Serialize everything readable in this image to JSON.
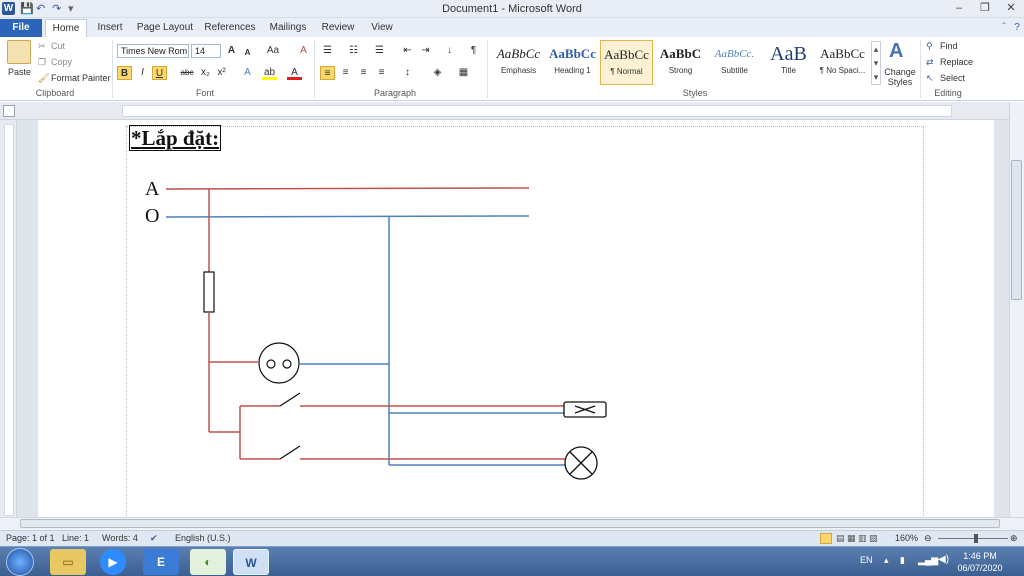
{
  "window": {
    "title": "Document1 - Microsoft Word",
    "app_icon": "W",
    "quick_access": [
      "save-icon",
      "undo-icon",
      "redo-icon"
    ],
    "controls": {
      "minimize": "–",
      "maximize": "❐",
      "close": "✕"
    }
  },
  "tabs": [
    "File",
    "Home",
    "Insert",
    "Page Layout",
    "References",
    "Mailings",
    "Review",
    "View"
  ],
  "ribbon": {
    "clipboard": {
      "label": "Clipboard",
      "paste": "Paste",
      "cut": "Cut",
      "copy": "Copy",
      "format_painter": "Format Painter"
    },
    "font": {
      "label": "Font",
      "family": "Times New Rom",
      "size": "14",
      "bold": "B",
      "italic": "I",
      "underline": "U",
      "strike": "abc",
      "sub": "x₂",
      "sup": "x²",
      "grow": "A",
      "shrink": "A",
      "case": "Aa",
      "clear": "A"
    },
    "paragraph": {
      "label": "Paragraph",
      "pilcrow": "¶"
    },
    "styles": {
      "label": "Styles",
      "items": [
        {
          "sample": "AaBbCc",
          "name": "Emphasis"
        },
        {
          "sample": "AaBbCc",
          "name": "Heading 1"
        },
        {
          "sample": "AaBbCc",
          "name": "¶ Normal"
        },
        {
          "sample": "AaBbC",
          "name": "Strong"
        },
        {
          "sample": "AaBbCc.",
          "name": "Subtitle"
        },
        {
          "sample": "AaB",
          "name": "Title"
        },
        {
          "sample": "AaBbCc",
          "name": "¶ No Spaci..."
        }
      ],
      "change_styles": "Change Styles"
    },
    "editing": {
      "label": "Editing",
      "find": "Find",
      "replace": "Replace",
      "select": "Select"
    }
  },
  "document": {
    "heading": "*Lắp đặt:",
    "label_a": "A",
    "label_o": "O"
  },
  "status": {
    "page": "Page: 1 of 1",
    "line": "Line: 1",
    "words": "Words: 4",
    "language": "English (U.S.)",
    "zoom": "160%"
  },
  "taskbar": {
    "lang": "EN",
    "time": "1:46 PM",
    "date": "06/07/2020"
  },
  "colors": {
    "phase_wire": "#c0504d",
    "neutral_wire": "#4f81bd",
    "accent": "#2b579a"
  }
}
